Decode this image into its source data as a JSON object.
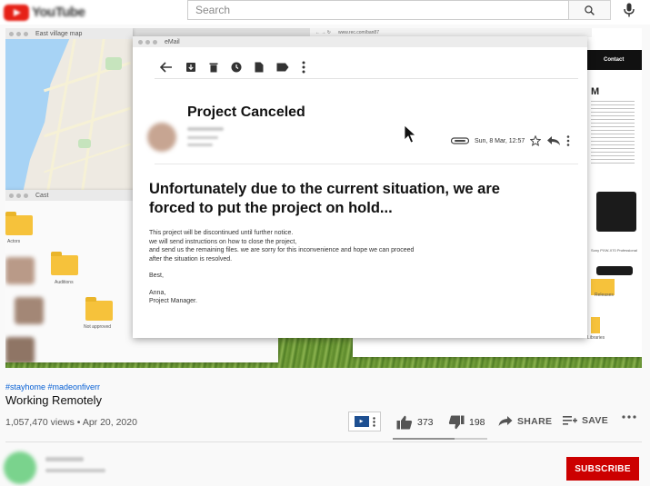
{
  "header": {
    "logo_text": "YouTube",
    "search_placeholder": "Search"
  },
  "video": {
    "map_window": {
      "title": "East village map"
    },
    "cast_window": {
      "title": "Cast",
      "folders": [
        "Actors",
        "Auditions",
        "Not approved"
      ]
    },
    "product_window": {
      "url": "www.rec.com/ban87",
      "nav_label": "Contact",
      "heading": "M",
      "camera_caption": "Sony PXW-X70 Professional",
      "folder_labels": [
        "Releases",
        "Libraries"
      ]
    },
    "email": {
      "window_title": "eMail",
      "subject": "Project Canceled",
      "date": "Sun, 8 Mar, 12:57",
      "headline": "Unfortunately due to the current situation, we are forced to put the project on hold...",
      "body_lines": [
        "This project will be discontinued until further notice.",
        " we will send instructions on how to close the project,",
        "and send us the remaining files. we are sorry for this inconvenience and hope we can proceed",
        "after the situation is resolved."
      ],
      "signoff": "Best,",
      "signature": [
        "Anna,",
        "Project Manager."
      ]
    }
  },
  "meta": {
    "hashtags": "#stayhome #madeonfiverr",
    "title": "Working Remotely",
    "views_date": "1,057,470 views • Apr 20, 2020",
    "likes": "373",
    "dislikes": "198",
    "like_ratio": 0.65,
    "share_label": "SHARE",
    "save_label": "SAVE",
    "subscribe_label": "SUBSCRIBE"
  },
  "colors": {
    "brand_red": "#cc0000",
    "link_blue": "#065fd4"
  }
}
